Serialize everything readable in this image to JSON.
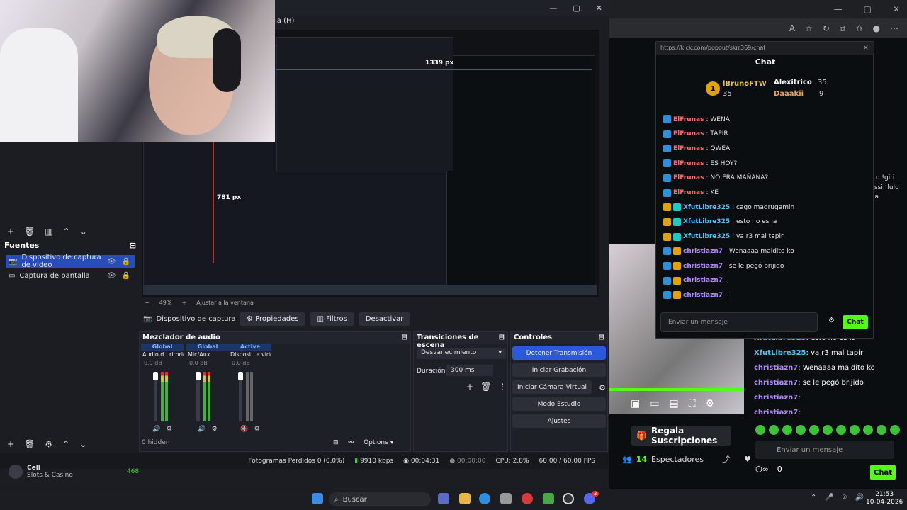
{
  "browser": {
    "window_controls": [
      "—",
      "▢",
      "✕"
    ],
    "toolbar_icons": [
      "A",
      "☆",
      "↻",
      "⧉",
      "✩",
      "●",
      "⋯"
    ]
  },
  "popout": {
    "url": "https://kick.com/popout/skrr369/chat",
    "close": "×",
    "title": "Chat",
    "leaders": [
      {
        "rank": "1",
        "name": "lBrunoFTW",
        "count": "35"
      },
      {
        "name": "Alexitrico",
        "count": "35"
      },
      {
        "name": "Daaakii",
        "count": "9"
      }
    ],
    "messages": [
      {
        "user": "ElFrunas",
        "text": ": WENA",
        "color": "#ff6b6b"
      },
      {
        "user": "ElFrunas",
        "text": ": TAPIR",
        "color": "#ff6b6b"
      },
      {
        "user": "ElFrunas",
        "text": ": QWEA",
        "color": "#ff6b6b"
      },
      {
        "user": "ElFrunas",
        "text": ": ES HOY?",
        "color": "#ff6b6b"
      },
      {
        "user": "ElFrunas",
        "text": ": NO ERA MAÑANA?",
        "color": "#ff6b6b"
      },
      {
        "user": "ElFrunas",
        "text": ": KE",
        "color": "#ff6b6b"
      },
      {
        "user": "XfutLibre325",
        "text": ": cago madrugamin",
        "color": "#4fc3f7"
      },
      {
        "user": "XfutLibre325",
        "text": ": esto no es ia",
        "color": "#4fc3f7"
      },
      {
        "user": "XfutLibre325",
        "text": ": va r3 mal tapir",
        "color": "#4fc3f7"
      },
      {
        "user": "christiazn7",
        "text": ": Wenaaaa maldito ko",
        "color": "#b587ff"
      },
      {
        "user": "christiazn7",
        "text": ": se le pegó brijido",
        "color": "#b587ff"
      },
      {
        "user": "christiazn7",
        "text": ":",
        "color": "#b587ff"
      },
      {
        "user": "christiazn7",
        "text": ":",
        "color": "#b587ff"
      }
    ],
    "input_placeholder": "Enviar un mensaje",
    "send_label": "Chat"
  },
  "kick_page": {
    "regala_label": "Regala Suscripciones",
    "viewers_count": "14",
    "viewers_label": "Espectadores",
    "chat_lines": [
      {
        "user": "XfutLibre325",
        "text": ": esto no es ia"
      },
      {
        "user": "XfutLibre325",
        "text": ": va r3 mal tapir"
      },
      {
        "user": "christiazn7",
        "text": ": Wenaaaa maldito ko"
      },
      {
        "user": "christiazn7",
        "text": ": se le pegó brijido"
      },
      {
        "user": "christiazn7",
        "text": ":"
      },
      {
        "user": "christiazn7",
        "text": ":"
      }
    ],
    "right_snippets": [
      "o !giri",
      "ssi !lulu",
      "ja"
    ],
    "input_placeholder": "Enviar un mensaje",
    "send_label": "Chat",
    "points": "0"
  },
  "obs": {
    "menu_fragment": "la (H)",
    "sources_title": "Fuentes",
    "sources": [
      {
        "label": "Dispositivo de captura de video",
        "active": true
      },
      {
        "label": "Captura de pantalla",
        "active": false
      }
    ],
    "zoom": "49%",
    "fit_label": "Ajustar a la ventana",
    "preview_overlay_1": "1339 px",
    "preview_overlay_2": "781 px",
    "source_toolbar": {
      "selected_source": "Dispositivo de captura de v",
      "properties": "Propiedades",
      "filters": "Filtros",
      "disable": "Desactivar"
    },
    "mixer": {
      "title": "Mezclador de audio",
      "channels": [
        {
          "tag": "Global",
          "name": "Audio d...ritorio",
          "db": "0.0 dB"
        },
        {
          "tag": "Global",
          "name": "Mic/Aux",
          "db": "0.0 dB"
        },
        {
          "tag": "Active",
          "name": "Disposi...e video",
          "db": "0.0 dB"
        }
      ],
      "scale": [
        "0",
        "-6",
        "-12",
        "-18",
        "-24",
        "-30",
        "-36",
        "-42",
        "-48",
        "-54",
        "-60"
      ],
      "hidden_label": "0 hidden",
      "options_label": "Options"
    },
    "transitions": {
      "title": "Transiciones de escena",
      "selected": "Desvanecimiento",
      "duration_label": "Duración",
      "duration_value": "300 ms"
    },
    "controls": {
      "title": "Controles",
      "buttons": [
        "Detener Transmisión",
        "Iniciar Grabación",
        "Iniciar Cámara Virtual",
        "Modo Estudio",
        "Ajustes"
      ]
    },
    "status": {
      "dropped": "Fotogramas Perdidos 0 (0.0%)",
      "bitrate": "9910 kbps",
      "stream_time": "00:04:31",
      "rec_time": "00:00:00",
      "cpu": "CPU: 2.8%",
      "fps": "60.00 / 60.00 FPS"
    },
    "profile_name": "Cell",
    "profile_sub": "Slots & Casino",
    "profile_count": "468"
  },
  "taskbar": {
    "search_label": "Buscar",
    "time": "21:53",
    "date": "10-04-2026",
    "notif_badge": "3"
  }
}
